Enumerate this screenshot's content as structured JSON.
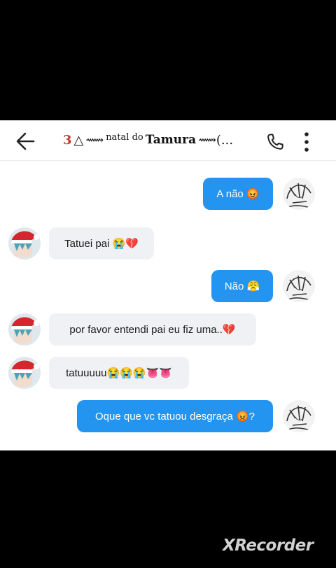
{
  "header": {
    "deco_left_1": "3",
    "deco_left_2": "△",
    "deco_left_3": "⟿",
    "title_small": "natal do",
    "title_big": "Tamura",
    "deco_right": "⟿(..."
  },
  "messages": [
    {
      "side": "out",
      "text": "A não 😡"
    },
    {
      "side": "in",
      "text": "Tatuei pai 😭💔"
    },
    {
      "side": "out",
      "text": "Não 😤"
    },
    {
      "side": "in",
      "text": "por favor entendi pai eu fiz uma..💔"
    },
    {
      "side": "in",
      "text": "tatuuuuu😭😭😭👅👅"
    },
    {
      "side": "out",
      "text": "Oque que vc tatuou desgraça 😡?"
    }
  ],
  "watermark": "XRecorder",
  "colors": {
    "outgoing_bubble": "#2394f0",
    "incoming_bubble": "#f0f1f4",
    "background": "#000000",
    "chat_panel": "#ffffff"
  },
  "icons": {
    "back": "arrow-left-icon",
    "call": "phone-icon",
    "more": "more-vertical-icon"
  }
}
